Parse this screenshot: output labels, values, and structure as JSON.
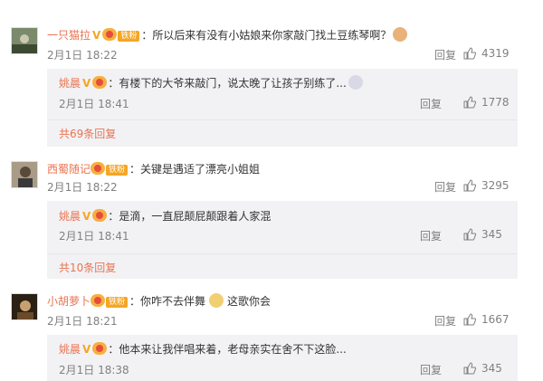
{
  "comments": [
    {
      "username": "一只猫拉",
      "badge": "铁粉",
      "text": "：所以后来有没有小姑娘来你家敲门找土豆练琴啊？",
      "time": "2月1日 18:22",
      "reply_label": "回复",
      "likes": "4319",
      "subreply": {
        "username": "姚晨",
        "text": "：有楼下的大爷来敲门，说太晚了让孩子别练了...",
        "time": "2月1日 18:41",
        "reply_label": "回复",
        "likes": "1778"
      },
      "more": "共69条回复"
    },
    {
      "username": "西蜀随记",
      "badge": "铁粉",
      "text": "：关键是遇适了漂亮小姐姐",
      "time": "2月1日 18:22",
      "reply_label": "回复",
      "likes": "3295",
      "subreply": {
        "username": "姚晨",
        "text": "：是滴，一直屁颠屁颠跟着人家混",
        "time": "2月1日 18:41",
        "reply_label": "回复",
        "likes": "345"
      },
      "more": "共10条回复"
    },
    {
      "username": "小胡萝卜",
      "badge": "铁粉",
      "text": "：你咋不去伴舞",
      "text_after_emoji": "这歌你会",
      "time": "2月1日 18:21",
      "reply_label": "回复",
      "likes": "1667",
      "subreply": {
        "username": "姚晨",
        "text": "：他本来让我伴唱来着，老母亲实在舍不下这脸...",
        "time": "2月1日 18:38",
        "reply_label": "回复",
        "likes": "345"
      }
    }
  ],
  "colors": {
    "username": "#eb7350",
    "meta": "#808080",
    "subbox": "#f2f2f5"
  },
  "icons": {
    "like": "thumbs-up-icon",
    "verified": "v-badge-icon",
    "crown": "crown-badge-icon"
  }
}
